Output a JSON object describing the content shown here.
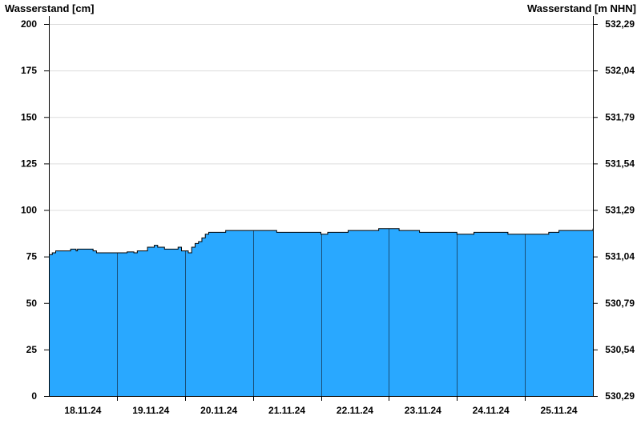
{
  "chart_data": {
    "type": "area",
    "y_left_label": "Wasserstand [cm]",
    "y_right_label": "Wasserstand [m NHN]",
    "y_left_ticks": [
      0,
      25,
      50,
      75,
      100,
      125,
      150,
      175,
      200
    ],
    "y_right_ticks": [
      "530,29",
      "530,54",
      "530,79",
      "531,04",
      "531,29",
      "531,54",
      "531,79",
      "532,04",
      "532,29"
    ],
    "ylim": [
      0,
      200
    ],
    "xlim_days": [
      17.5,
      25.5
    ],
    "x_ticks": [
      {
        "day": 18,
        "label": "18.11.24"
      },
      {
        "day": 19,
        "label": "19.11.24"
      },
      {
        "day": 20,
        "label": "20.11.24"
      },
      {
        "day": 21,
        "label": "21.11.24"
      },
      {
        "day": 22,
        "label": "22.11.24"
      },
      {
        "day": 23,
        "label": "23.11.24"
      },
      {
        "day": 24,
        "label": "24.11.24"
      },
      {
        "day": 25,
        "label": "25.11.24"
      }
    ],
    "day_boundaries": [
      18.5,
      19.5,
      20.5,
      21.5,
      22.5,
      23.5,
      24.5
    ],
    "grid": "horizontal",
    "fill_color": "#29a8ff",
    "line_color": "#000000",
    "series": [
      {
        "x": [
          17.5,
          17.55,
          17.6,
          17.8,
          17.82,
          17.9,
          17.92,
          18.15,
          18.2,
          18.35,
          18.4,
          18.6,
          18.65,
          18.75,
          18.8,
          18.9,
          18.95,
          19.05,
          19.1,
          19.2,
          19.25,
          19.3,
          19.4,
          19.45,
          19.55,
          19.6,
          19.65,
          19.7,
          19.75,
          19.8,
          19.85,
          19.9,
          20.0,
          20.1,
          20.3,
          20.35,
          20.8,
          20.85,
          21.3,
          21.35,
          21.5,
          21.55,
          21.6,
          21.65,
          21.9,
          22.0,
          22.3,
          22.35,
          22.65,
          22.7,
          22.95,
          23.0,
          23.5,
          23.55,
          23.7,
          23.75,
          24.0,
          24.25,
          24.3,
          24.45,
          24.5,
          24.85,
          24.9,
          25.0,
          25.45,
          25.5
        ],
        "y": [
          76,
          77,
          78,
          78,
          79,
          78,
          79,
          78,
          77,
          77,
          77,
          77,
          77.5,
          77,
          78,
          78,
          80,
          81,
          80,
          79,
          79,
          79,
          80,
          78,
          77,
          80,
          82,
          83,
          85,
          87,
          88,
          88,
          88,
          89,
          89,
          89,
          89,
          88,
          88,
          88,
          87,
          87,
          88,
          88,
          89,
          89,
          89,
          90,
          89,
          89,
          88,
          88,
          87,
          87,
          87,
          88,
          88,
          87,
          87,
          87,
          87,
          88,
          88,
          89,
          89,
          90
        ]
      }
    ]
  }
}
